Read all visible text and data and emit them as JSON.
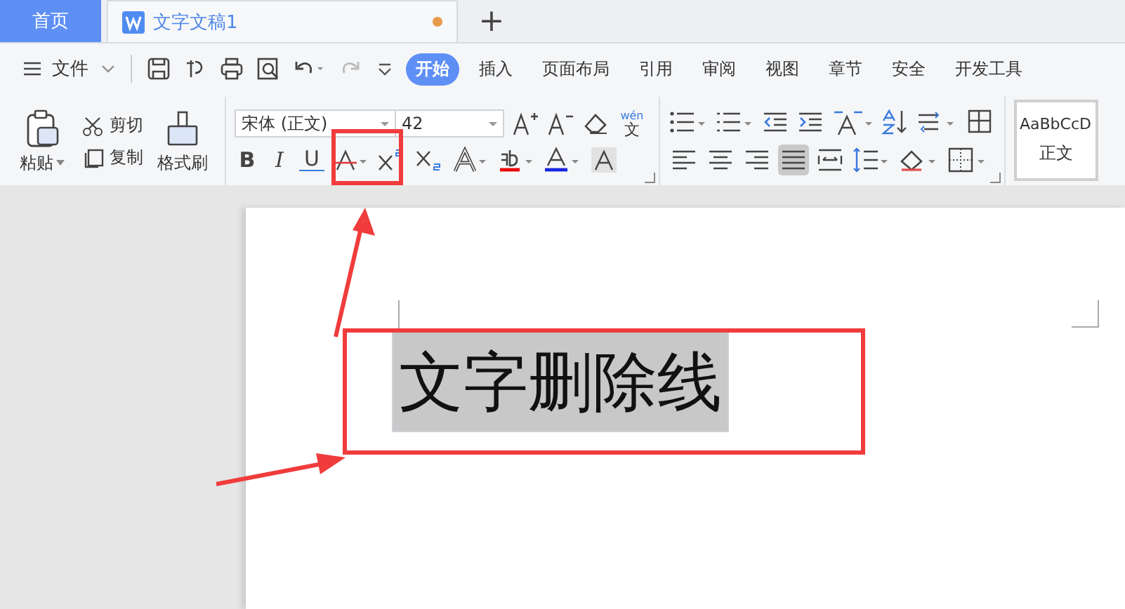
{
  "tabs": [
    {
      "label": "首页",
      "kind": "home",
      "selected": false
    },
    {
      "label": "文字文稿1",
      "kind": "doc",
      "selected": true,
      "unsaved": true
    }
  ],
  "new_tab": "+",
  "menu": {
    "file": "文件",
    "items": [
      {
        "label": "开始",
        "selected": true
      },
      {
        "label": "插入",
        "selected": false
      },
      {
        "label": "页面布局",
        "selected": false
      },
      {
        "label": "引用",
        "selected": false
      },
      {
        "label": "审阅",
        "selected": false
      },
      {
        "label": "视图",
        "selected": false
      },
      {
        "label": "章节",
        "selected": false
      },
      {
        "label": "安全",
        "selected": false
      },
      {
        "label": "开发工具",
        "selected": false
      }
    ]
  },
  "clipboard": {
    "paste": "粘贴",
    "cut": "剪切",
    "copy": "复制",
    "format_painter": "格式刷"
  },
  "font": {
    "family": "宋体 (正文)",
    "size": "42",
    "bold": "B",
    "italic": "I",
    "underline": "U",
    "pinyin": "wén",
    "pinyin_char": "文"
  },
  "alignments": [
    {
      "kind": "left",
      "selected": false
    },
    {
      "kind": "center",
      "selected": false
    },
    {
      "kind": "right",
      "selected": false
    },
    {
      "kind": "justify",
      "selected": true
    },
    {
      "kind": "distributed",
      "selected": false
    }
  ],
  "styles": {
    "preview": "AaBbCcD",
    "name": "正文"
  },
  "document": {
    "text": "文字删除线",
    "selected": true
  }
}
